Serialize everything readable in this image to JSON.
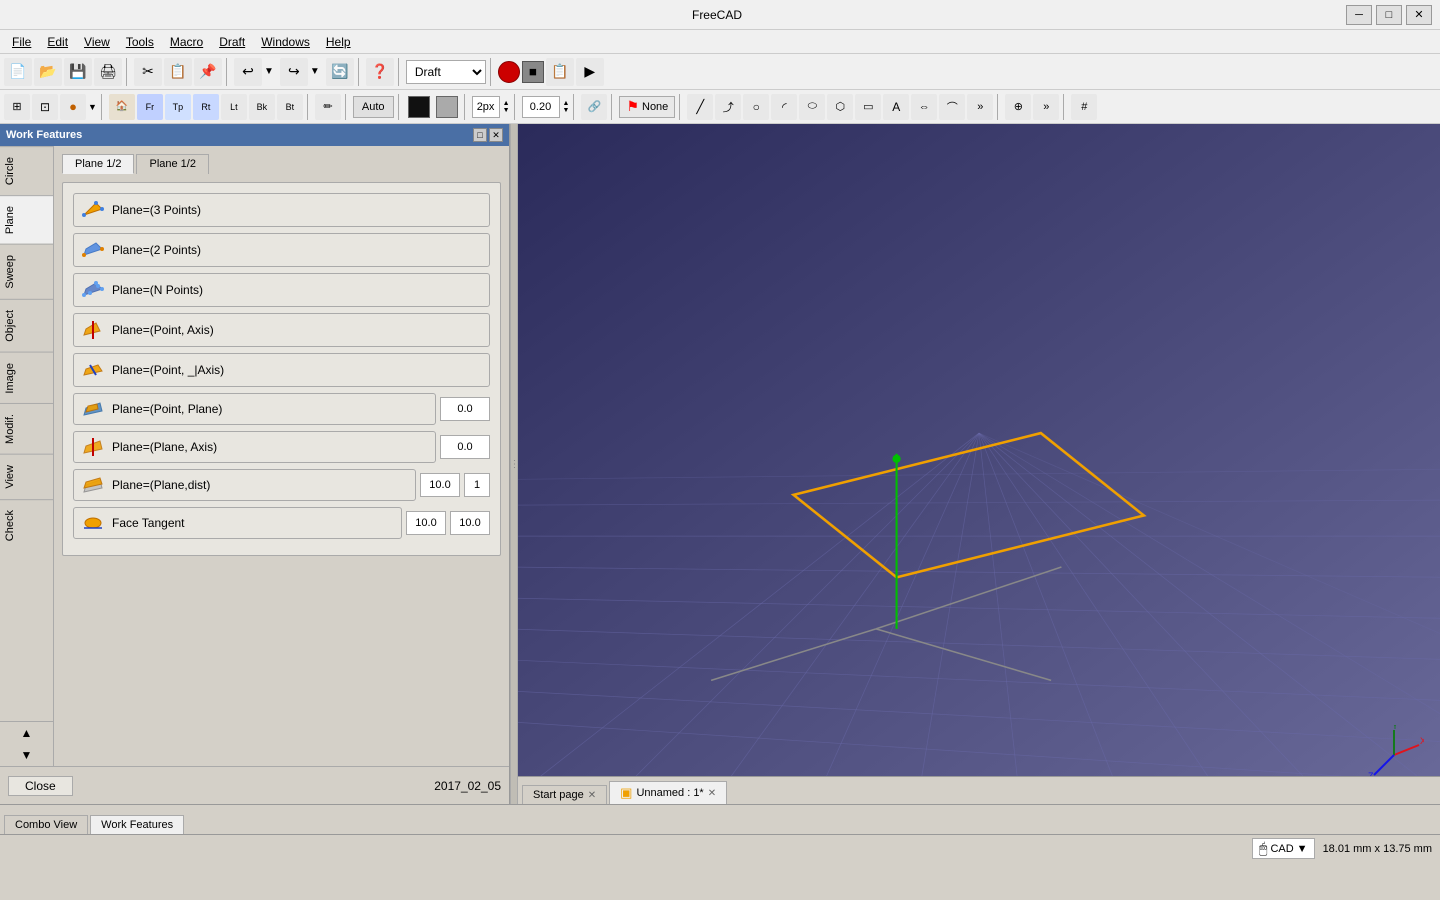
{
  "app": {
    "title": "FreeCAD",
    "min_label": "─",
    "max_label": "□",
    "close_label": "✕"
  },
  "menu": {
    "items": [
      "File",
      "Edit",
      "View",
      "Tools",
      "Macro",
      "Draft",
      "Windows",
      "Help"
    ]
  },
  "toolbar1": {
    "buttons": [
      "📄",
      "📁",
      "💾",
      "🖨",
      "✂",
      "📋",
      "📌",
      "↩",
      "↪",
      "🔄",
      "❓"
    ],
    "workbench": "Draft"
  },
  "toolbar2": {
    "snap_mode": "Auto",
    "px_value": "2px",
    "num_value": "0.20",
    "none_label": "None"
  },
  "panel": {
    "title": "Work Features",
    "tabs": [
      "Plane 1/2",
      "Plane 1/2"
    ],
    "close_btn": "Close",
    "date_text": "2017_02_05",
    "side_tabs": [
      "Circle",
      "Plane",
      "Sweep",
      "Object",
      "Image",
      "Modif.",
      "View",
      "Check"
    ],
    "buttons": [
      {
        "label": "Plane=(3 Points)",
        "type": "simple"
      },
      {
        "label": "Plane=(2 Points)",
        "type": "simple"
      },
      {
        "label": "Plane=(N Points)",
        "type": "simple"
      },
      {
        "label": "Plane=(Point, Axis)",
        "type": "simple"
      },
      {
        "label": "Plane=(Point, _|Axis)",
        "type": "simple"
      },
      {
        "label": "Plane=(Point, Plane)",
        "type": "input1",
        "val1": "0.0"
      },
      {
        "label": "Plane=(Plane, Axis)",
        "type": "input1",
        "val1": "0.0"
      },
      {
        "label": "Plane=(Plane,dist)",
        "type": "input2",
        "val1": "10.0",
        "val2": "1"
      },
      {
        "label": "Face Tangent",
        "type": "input2",
        "val1": "10.0",
        "val2": "10.0"
      }
    ]
  },
  "bottom_tabs": [
    {
      "label": "Combo View",
      "active": false,
      "closeable": false
    },
    {
      "label": "Work Features",
      "active": true,
      "closeable": false
    }
  ],
  "canvas_tabs": [
    {
      "label": "Start page",
      "active": false,
      "closeable": true
    },
    {
      "label": "Unnamed : 1*",
      "active": true,
      "closeable": true
    }
  ],
  "status": {
    "cad_label": "CAD",
    "dimensions": "18.01 mm x 13.75 mm"
  }
}
